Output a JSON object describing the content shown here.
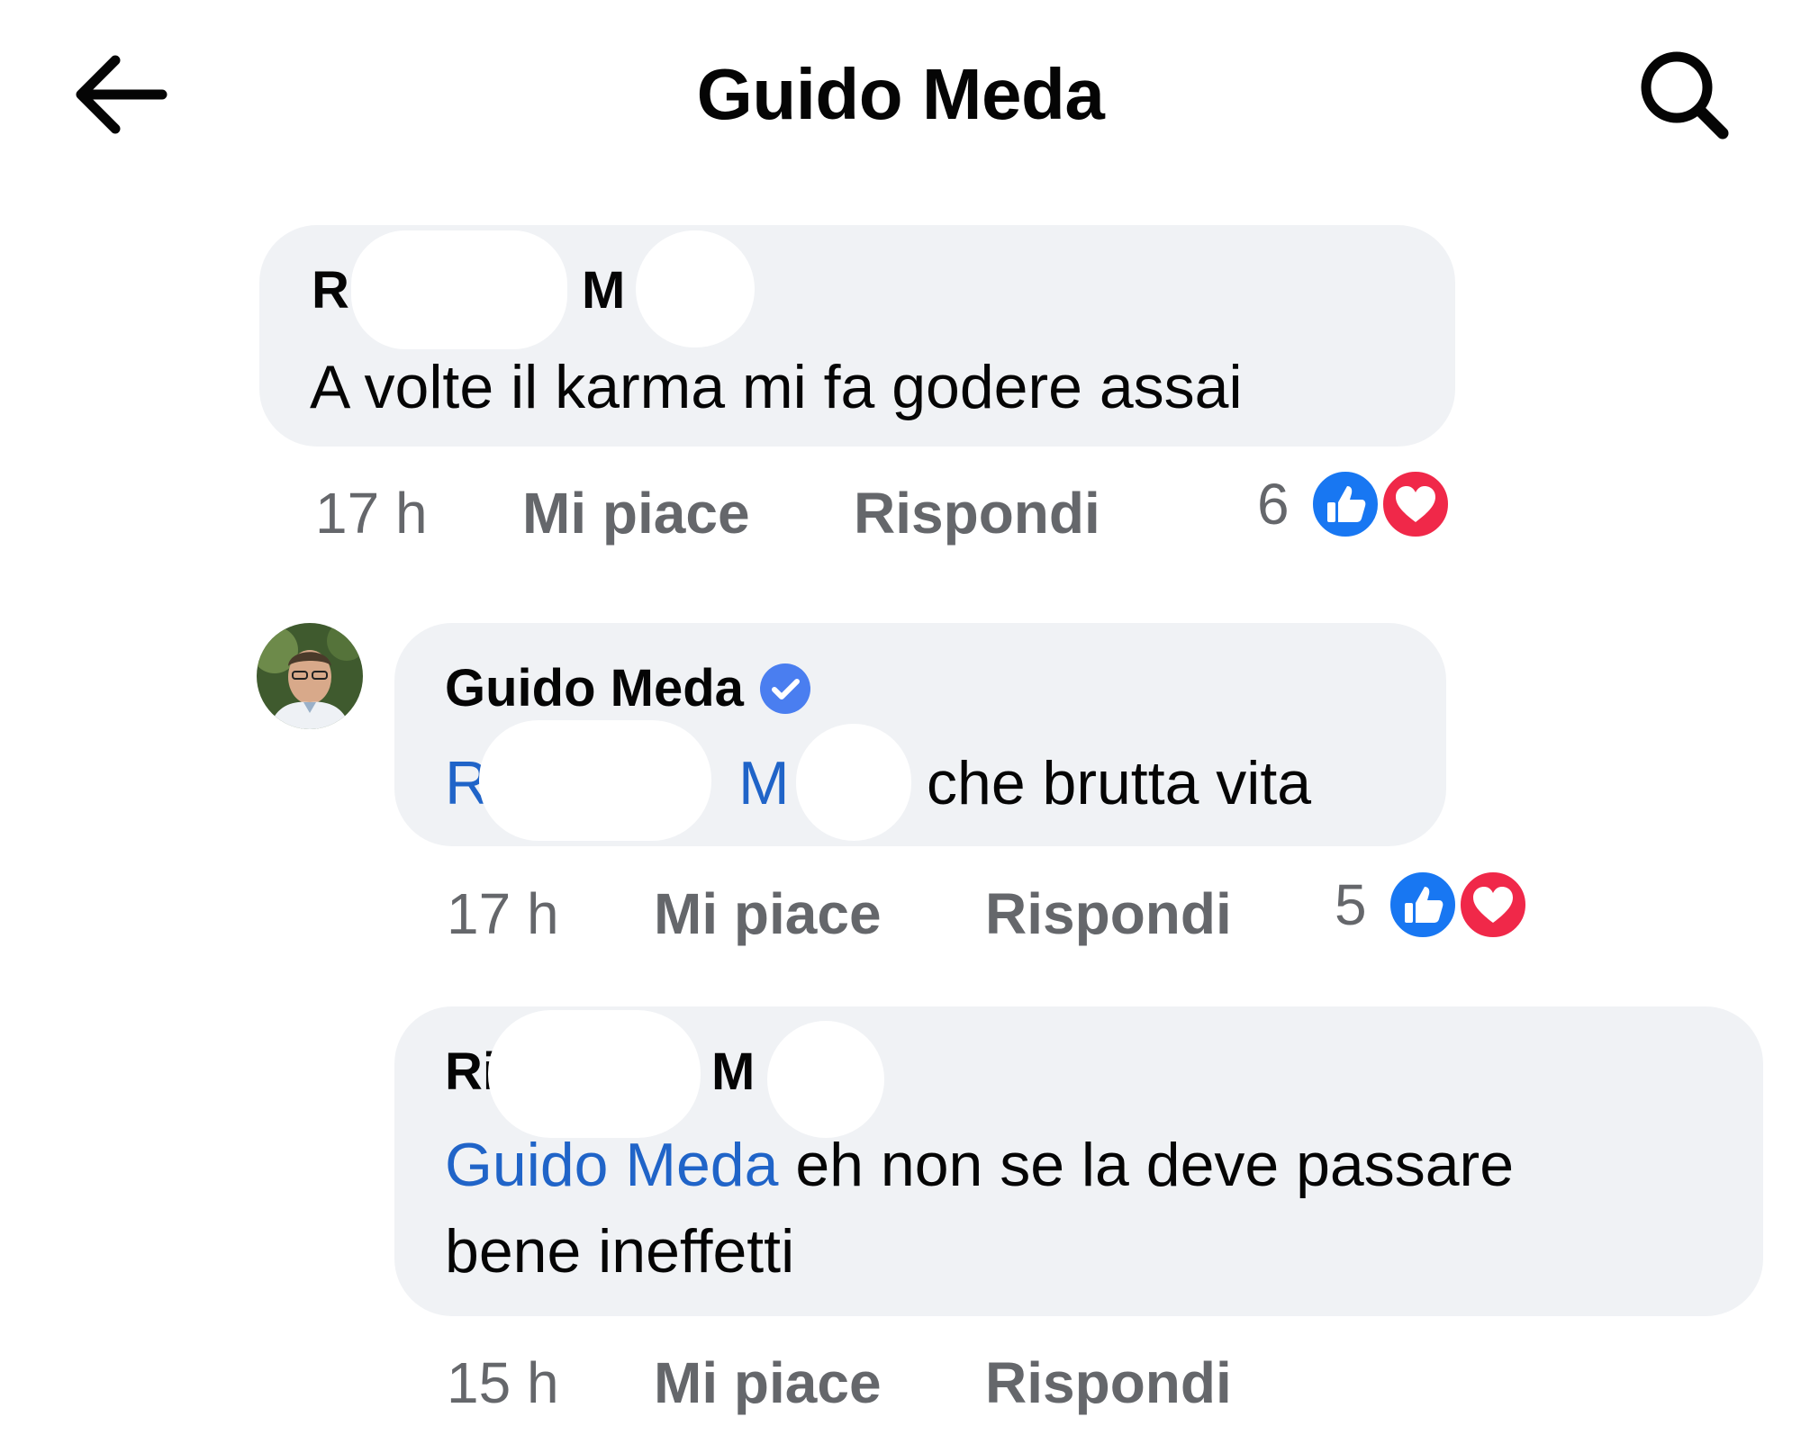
{
  "header": {
    "title": "Guido Meda",
    "back_icon": "arrow-left-icon",
    "search_icon": "search-icon"
  },
  "colors": {
    "bubble": "#f0f2f5",
    "mention": "#2064c8",
    "meta": "#65676b",
    "like_blue": "#1877f2",
    "love_red": "#f02849",
    "verified_blue": "#4a7ef0"
  },
  "comments": [
    {
      "author_initial_1": "R",
      "author_initial_2": "M",
      "text": "A volte il karma mi fa godere assai",
      "time": "17 h",
      "like_label": "Mi piace",
      "reply_label": "Rispondi",
      "reaction_count": "6"
    },
    {
      "author": "Guido Meda",
      "verified": true,
      "mention_initial_1": "R",
      "mention_initial_2": "M",
      "text": "che brutta vita",
      "time": "17 h",
      "like_label": "Mi piace",
      "reply_label": "Rispondi",
      "reaction_count": "5"
    },
    {
      "author_initial_1": "Ri",
      "author_initial_2": "M",
      "mention": "Guido Meda",
      "text_line1": " eh non se la deve passare",
      "text_line2": "bene ineffetti",
      "time": "15 h",
      "like_label": "Mi piace",
      "reply_label": "Rispondi"
    }
  ]
}
